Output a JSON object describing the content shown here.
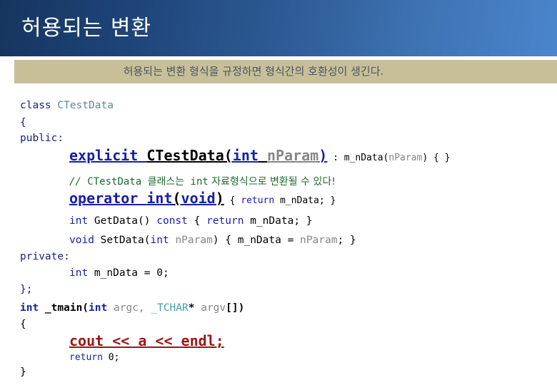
{
  "slide": {
    "title": "허용되는 변환",
    "subtitle": "허용되는 변환 형식을 규정하면 형식간의 호환성이 생긴다.",
    "header_gradient_start": "#16355e",
    "header_gradient_end": "#4a85cc",
    "subtitle_band_color": "#c7bf98",
    "subtitle_text_color": "#4b5464"
  },
  "code": {
    "language": "cpp",
    "colors": {
      "keyword": "#18227a",
      "classname": "#5f8a8f",
      "plain": "#000000",
      "parameter": "#868686",
      "comment": "#1f6b2e",
      "tchar": "#3fa3ab",
      "highlight_red": "#9e1616"
    },
    "lines": {
      "l1_class": "class ",
      "l1_name": "CTestData",
      "l2_brace": "{",
      "l3_public": "public:",
      "l4_explicit": "explicit ",
      "l4_ctor": "CTestData(",
      "l4_int": "int",
      "l4_space": " ",
      "l4_param": "nParam",
      "l4_close": ")",
      "l4_init": " : m_nData(",
      "l4_init_param": "nParam",
      "l4_init_tail": ") { }",
      "l5_comment_slashes": "// ",
      "l5_comment_a": "CTestData 클래스는 ",
      "l5_comment_int": "int",
      "l5_comment_b": " 자료형식으로 변환될 수 있다!",
      "l6_operator": "operator ",
      "l6_int": "int",
      "l6_paren_open": "(",
      "l6_void": "void",
      "l6_paren_close": ")",
      "l6_body_open": " { ",
      "l6_return": "return",
      "l6_body_rest": " m_nData; }",
      "l7_int": "int",
      "l7_getdata": " GetData() ",
      "l7_const": "const",
      "l7_open": " { ",
      "l7_return": "return",
      "l7_rest": " m_nData; }",
      "l8_void": "void",
      "l8_setdata": " SetData(",
      "l8_int": "int",
      "l8_space": " ",
      "l8_param": "nParam",
      "l8_rest": ") { m_nData = ",
      "l8_param2": "nParam",
      "l8_tail": "; }",
      "l9_private": "private:",
      "l10_int": "int",
      "l10_rest": " m_nData = 0;",
      "l11_end": "};",
      "l12_int": "int",
      "l12_tmain": " _tmain(",
      "l12_int2": "int",
      "l12_argc": " argc, ",
      "l12_tchar": "_TCHAR",
      "l12_star": "* ",
      "l12_argv": "argv",
      "l12_brackets": "[])",
      "l13_brace": "{",
      "l14_cout": "cout << a << endl;",
      "l15_return": "return",
      "l15_zero": " 0;",
      "l16_brace": "}"
    }
  }
}
